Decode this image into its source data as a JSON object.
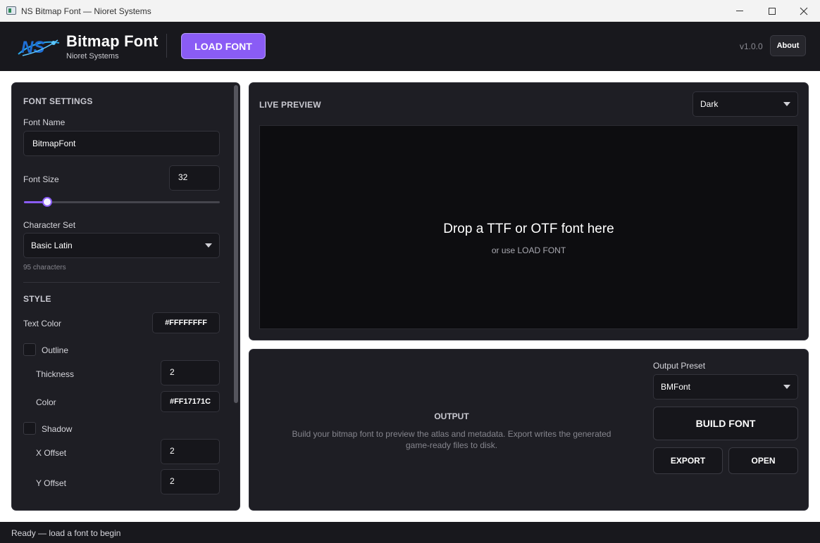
{
  "window": {
    "title": "NS Bitmap Font — Nioret Systems"
  },
  "header": {
    "brand_title": "Bitmap Font",
    "brand_subtitle": "Nioret Systems",
    "load_font_label": "LOAD FONT",
    "version": "v1.0.0",
    "about_label": "About"
  },
  "font_settings": {
    "heading": "FONT SETTINGS",
    "font_name_label": "Font Name",
    "font_name_value": "BitmapFont",
    "font_size_label": "Font Size",
    "font_size_value": "32",
    "font_size_slider_fraction": 0.12,
    "character_set_label": "Character Set",
    "character_set_value": "Basic Latin",
    "character_count": "95 characters"
  },
  "style": {
    "heading": "STYLE",
    "text_color_label": "Text Color",
    "text_color_value": "#FFFFFFFF",
    "outline_label": "Outline",
    "outline_checked": false,
    "thickness_label": "Thickness",
    "thickness_value": "2",
    "color_label": "Color",
    "color_value": "#FF17171C",
    "shadow_label": "Shadow",
    "shadow_checked": false,
    "x_offset_label": "X Offset",
    "x_offset_value": "2",
    "y_offset_label": "Y Offset",
    "y_offset_value": "2"
  },
  "preview": {
    "heading": "LIVE PREVIEW",
    "theme_value": "Dark",
    "drop_message": "Drop a TTF or OTF font here",
    "drop_hint": "or use LOAD FONT"
  },
  "output": {
    "heading": "OUTPUT",
    "description": "Build your bitmap font to preview the atlas and metadata. Export writes the generated game-ready files to disk.",
    "preset_label": "Output Preset",
    "preset_value": "BMFont",
    "build_label": "BUILD FONT",
    "export_label": "EXPORT",
    "open_label": "OPEN"
  },
  "status": {
    "text": "Ready — load a font to begin"
  },
  "colors": {
    "accent": "#8a5cf5",
    "panel": "#1e1e24",
    "header": "#18181d"
  }
}
